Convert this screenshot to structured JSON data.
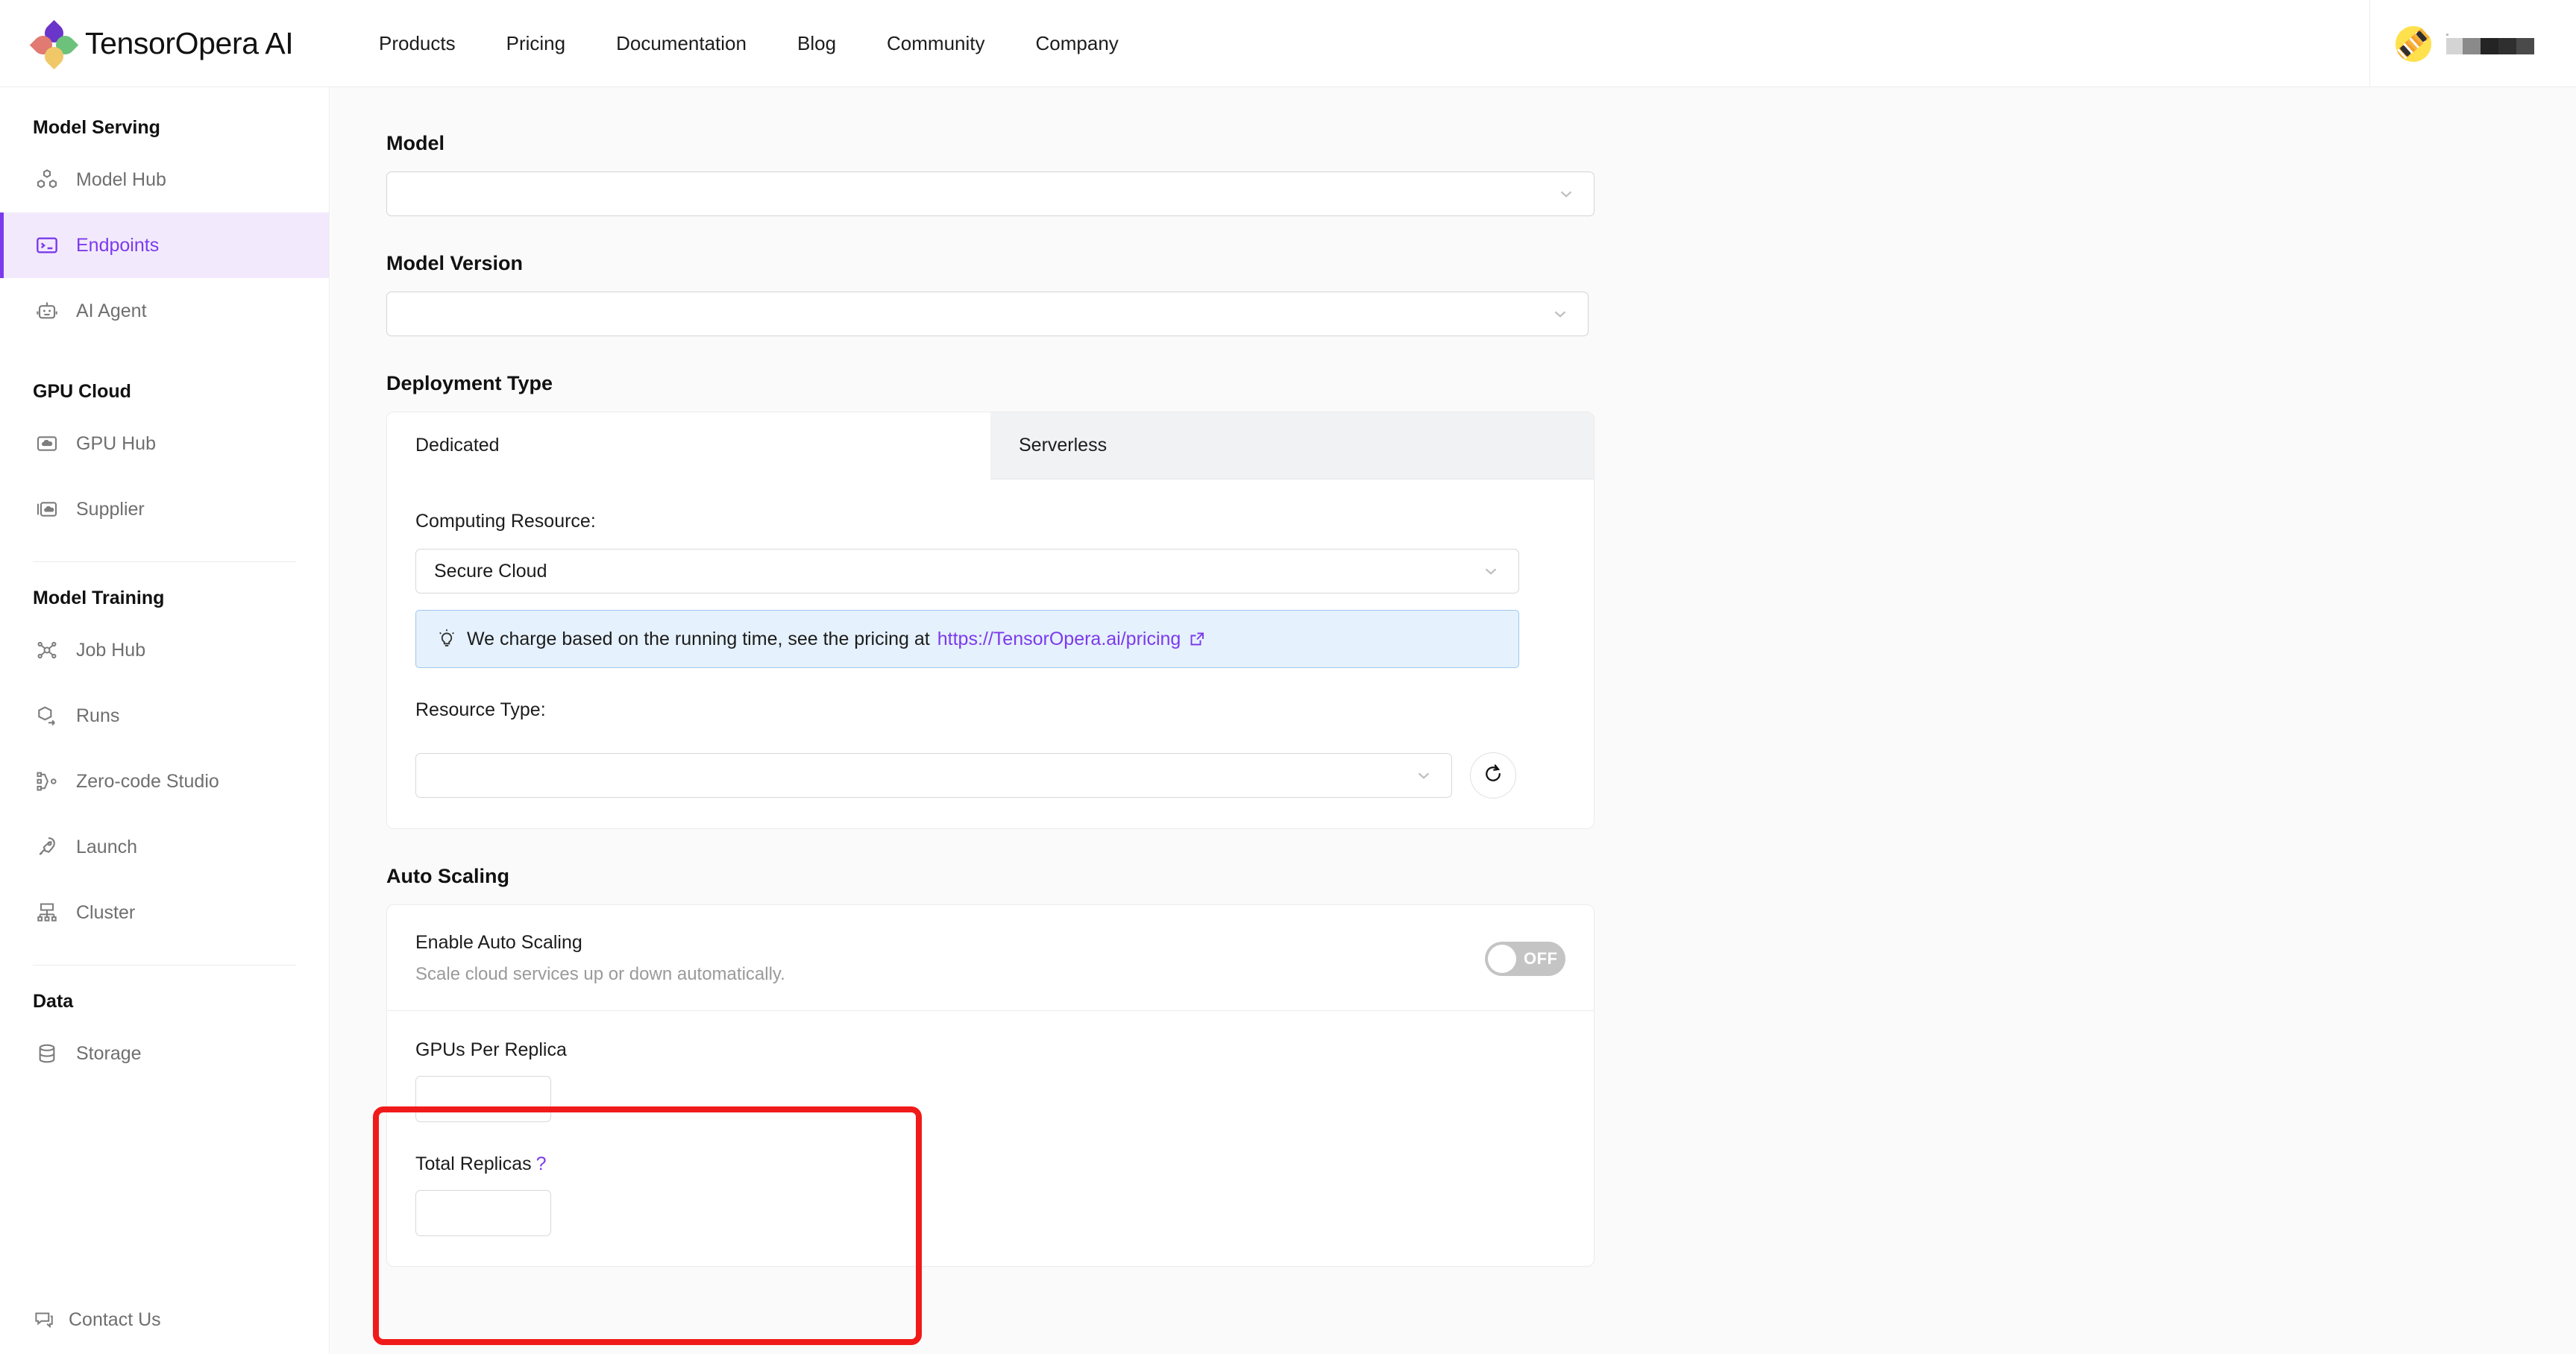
{
  "brand": {
    "name": "TensorOpera AI",
    "logo_icon": "flower-logo-icon"
  },
  "topnav": {
    "items": [
      {
        "label": "Products"
      },
      {
        "label": "Pricing"
      },
      {
        "label": "Documentation"
      },
      {
        "label": "Blog"
      },
      {
        "label": "Community"
      },
      {
        "label": "Company"
      }
    ]
  },
  "account": {
    "avatar_icon": "skateboard-avatar-icon",
    "username": ""
  },
  "sidebar": {
    "groups": [
      {
        "title": "Model Serving",
        "items": [
          {
            "label": "Model Hub",
            "icon": "cubes-icon",
            "active": false
          },
          {
            "label": "Endpoints",
            "icon": "terminal-icon",
            "active": true
          },
          {
            "label": "AI Agent",
            "icon": "robot-icon",
            "active": false
          }
        ]
      },
      {
        "title": "GPU Cloud",
        "items": [
          {
            "label": "GPU Hub",
            "icon": "cloud-box-icon",
            "active": false
          },
          {
            "label": "Supplier",
            "icon": "folders-cloud-icon",
            "active": false
          }
        ]
      },
      {
        "title": "Model Training",
        "items": [
          {
            "label": "Job Hub",
            "icon": "network-nodes-icon",
            "active": false
          },
          {
            "label": "Runs",
            "icon": "cube-arrow-icon",
            "active": false
          },
          {
            "label": "Zero-code Studio",
            "icon": "flow-nodes-icon",
            "active": false
          },
          {
            "label": "Launch",
            "icon": "rocket-icon",
            "active": false
          },
          {
            "label": "Cluster",
            "icon": "cluster-icon",
            "active": false
          }
        ]
      },
      {
        "title": "Data",
        "items": [
          {
            "label": "Storage",
            "icon": "database-icon",
            "active": false
          }
        ]
      }
    ],
    "contact": {
      "label": "Contact Us",
      "icon": "chat-bubble-icon"
    }
  },
  "form": {
    "model": {
      "label": "Model",
      "value": "",
      "placeholder": ""
    },
    "model_version": {
      "label": "Model Version",
      "value": "",
      "placeholder": ""
    },
    "deployment_type": {
      "label": "Deployment Type",
      "tabs": [
        {
          "label": "Dedicated",
          "active": true
        },
        {
          "label": "Serverless",
          "active": false
        }
      ],
      "computing_resource": {
        "label": "Computing Resource:",
        "value": "Secure Cloud"
      },
      "note": {
        "icon": "lightbulb-icon",
        "text": "We charge based on the running time, see the pricing at",
        "link_text": "https://TensorOpera.ai/pricing",
        "link_icon": "external-link-icon"
      },
      "resource_type": {
        "label": "Resource Type:",
        "value": "",
        "refresh_icon": "refresh-icon"
      }
    },
    "auto_scaling": {
      "label": "Auto Scaling",
      "enable": {
        "title": "Enable Auto Scaling",
        "description": "Scale cloud services up or down automatically.",
        "toggle_state": "OFF"
      },
      "gpus_per_replica": {
        "label": "GPUs Per Replica",
        "value": ""
      },
      "total_replicas": {
        "label": "Total Replicas",
        "help": "?",
        "value": ""
      }
    }
  },
  "colors": {
    "accent_purple": "#7c3aed",
    "active_bg": "#f2eafc",
    "note_bg": "#e5f1fd",
    "note_border": "#9ec9f0",
    "annotation_red": "#f11a1a",
    "avatar_yellow": "#FFE14D"
  }
}
